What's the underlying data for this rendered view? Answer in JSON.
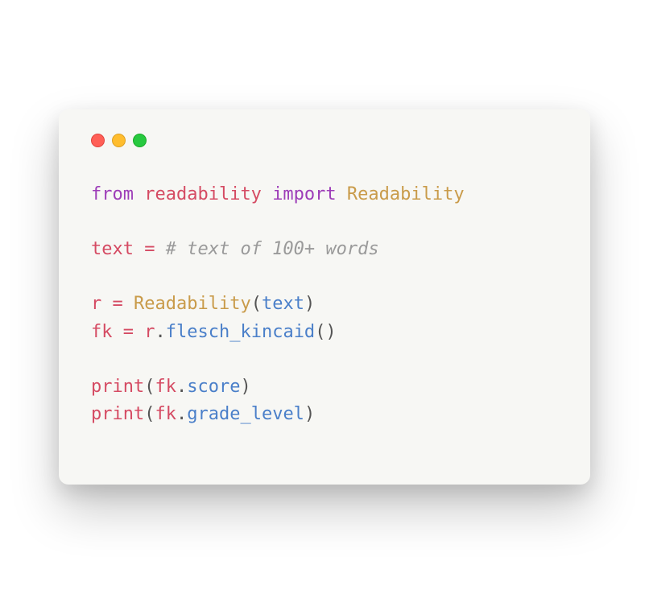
{
  "traffic_lights": {
    "red": "#ff5f56",
    "yellow": "#ffbd2e",
    "green": "#27c93f"
  },
  "code": {
    "line1": {
      "from": "from",
      "module": "readability",
      "import": "import",
      "class": "Readability"
    },
    "line3": {
      "var": "text",
      "eq": " = ",
      "comment": "# text of 100+ words"
    },
    "line5": {
      "var": "r",
      "eq": " = ",
      "cls": "Readability",
      "open": "(",
      "arg": "text",
      "close": ")"
    },
    "line6": {
      "var": "fk",
      "eq": " = ",
      "obj": "r",
      "dot": ".",
      "method": "flesch_kincaid",
      "parens": "()"
    },
    "line8": {
      "fn": "print",
      "open": "(",
      "obj": "fk",
      "dot": ".",
      "attr": "score",
      "close": ")"
    },
    "line9": {
      "fn": "print",
      "open": "(",
      "obj": "fk",
      "dot": ".",
      "attr": "grade_level",
      "close": ")"
    }
  }
}
